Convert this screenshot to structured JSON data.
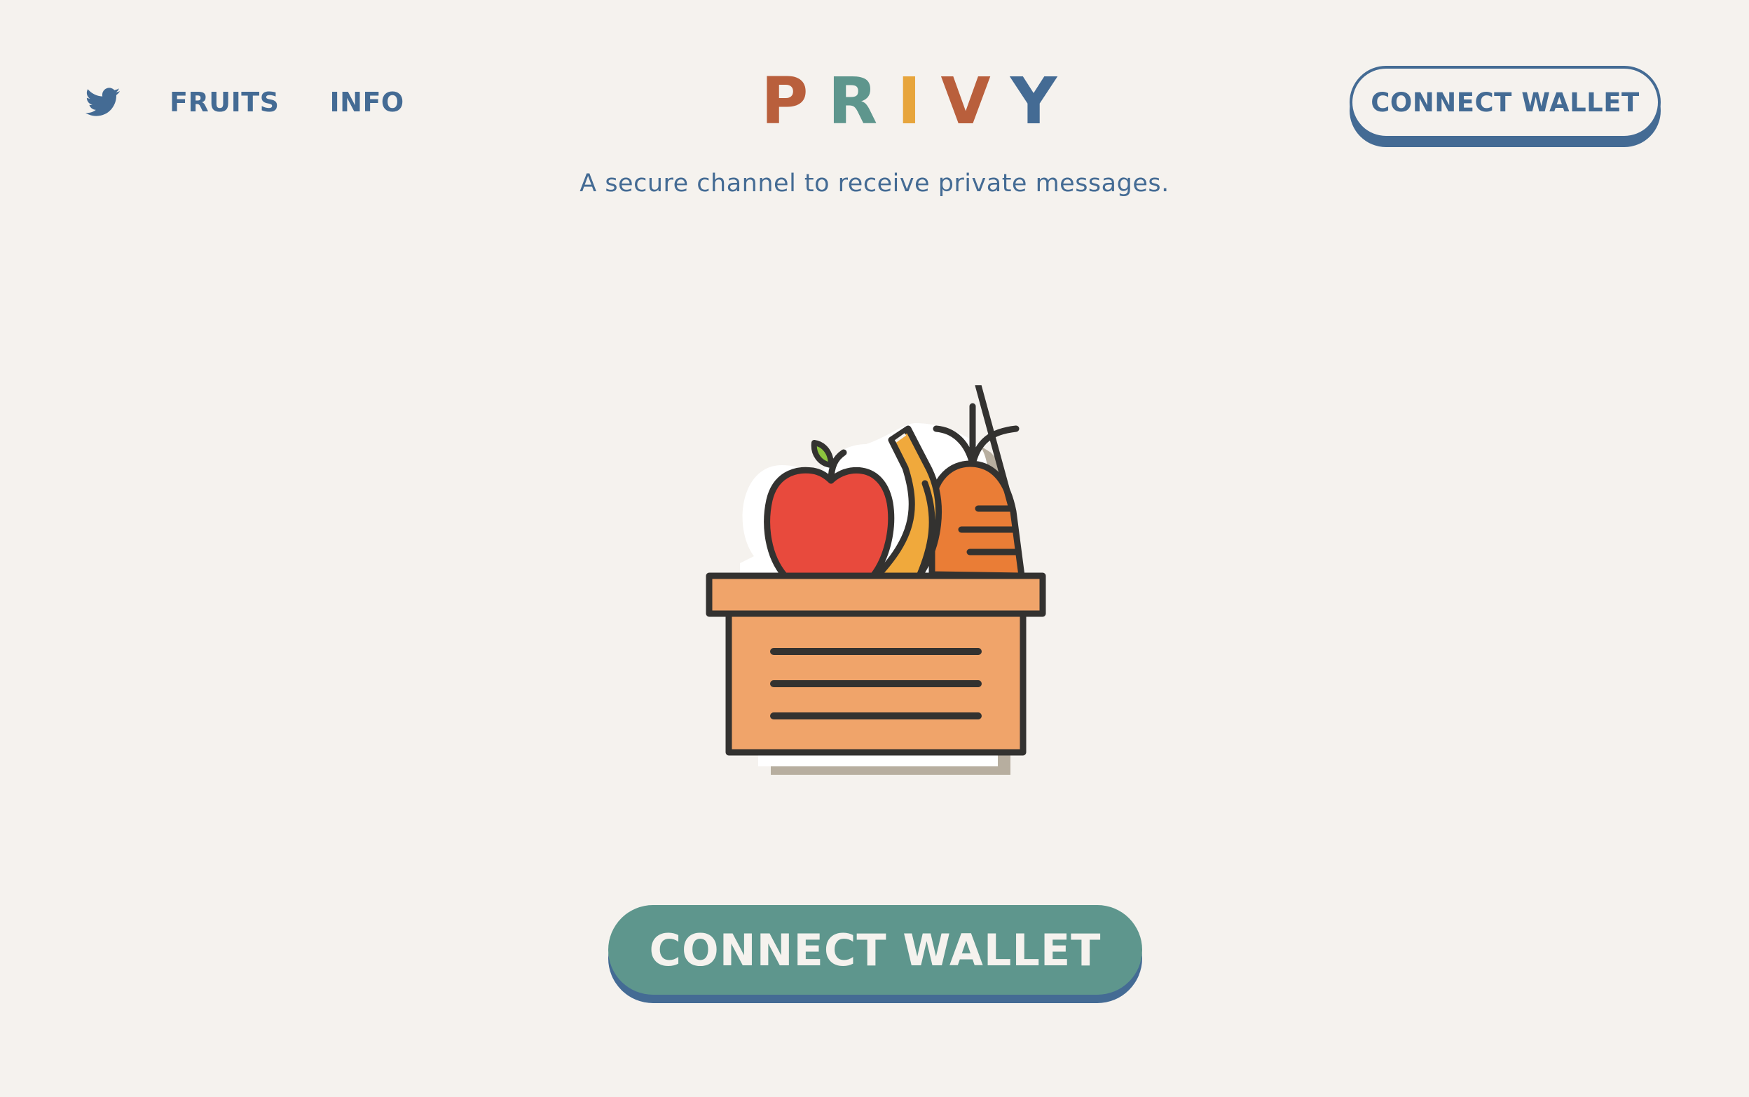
{
  "nav": {
    "twitter_icon": "twitter-bird-icon",
    "links": [
      {
        "label": "FRUITS"
      },
      {
        "label": "INFO"
      }
    ]
  },
  "logo": {
    "letters": [
      {
        "char": "P",
        "color": "#b95f3c"
      },
      {
        "char": "R",
        "color": "#5e968d"
      },
      {
        "char": "I",
        "color": "#e7a53c"
      },
      {
        "char": "V",
        "color": "#b95f3c"
      },
      {
        "char": "Y",
        "color": "#446b94"
      }
    ]
  },
  "tagline": "A secure channel to receive private messages.",
  "header_button": {
    "label": "CONNECT WALLET"
  },
  "hero": {
    "illustration": "fruit-basket-icon"
  },
  "main_button": {
    "label": "CONNECT WALLET"
  },
  "colors": {
    "background": "#f5f2ee",
    "primary_blue": "#446b94",
    "teal": "#5e968d"
  }
}
